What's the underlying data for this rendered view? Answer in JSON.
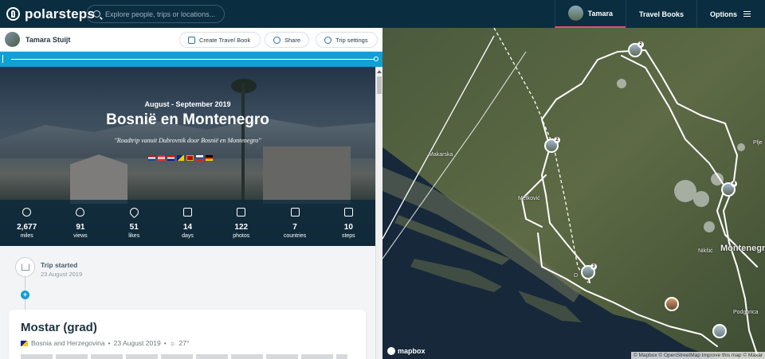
{
  "app": {
    "logo_text": "polarsteps"
  },
  "search": {
    "placeholder": "Explore people, trips or locations..."
  },
  "nav": {
    "user_name": "Tamara",
    "travel_books": "Travel Books",
    "options": "Options"
  },
  "trip_header": {
    "owner": "Tamara Stuijt",
    "create_book": "Create Travel Book",
    "share": "Share",
    "trip_settings": "Trip settings"
  },
  "hero": {
    "dates": "August - September 2019",
    "title": "Bosnië en Montenegro",
    "quote": "\"Roadtrip vanuit Dubrovnik door Bosnië en Montenegro\"",
    "flags": [
      "netherlands",
      "austria",
      "croatia",
      "bosnia",
      "montenegro",
      "slovenia",
      "germany"
    ]
  },
  "stats": [
    {
      "icon": "compass-icon",
      "value": "2,677",
      "label": "miles"
    },
    {
      "icon": "eye-icon",
      "value": "91",
      "label": "views"
    },
    {
      "icon": "heart-icon",
      "value": "51",
      "label": "likes"
    },
    {
      "icon": "calendar-icon",
      "value": "14",
      "label": "days"
    },
    {
      "icon": "camera-icon",
      "value": "122",
      "label": "photos"
    },
    {
      "icon": "passport-icon",
      "value": "7",
      "label": "countries"
    },
    {
      "icon": "footprint-icon",
      "value": "10",
      "label": "steps"
    }
  ],
  "timeline": {
    "started_title": "Trip started",
    "started_date": "23 August 2019",
    "step": {
      "title": "Mostar (grad)",
      "country": "Bosnia and Herzegovina",
      "date": "23 August 2019",
      "temp": "27°"
    }
  },
  "map": {
    "labels": {
      "makarska": "Makarska",
      "metkovic": "Metković",
      "montenegro": "Montenegro",
      "nikšić": "Nikšić",
      "pljevlja": "Plje",
      "podgorica": "Podgorica",
      "dubrovnik": "D"
    },
    "pins": [
      {
        "badge": "2"
      },
      {
        "badge": "2"
      },
      {
        "badge": "4"
      },
      {
        "badge": "3"
      }
    ],
    "brand": "mapbox",
    "attribution": "© Mapbox © OpenStreetMap  Improve this map © Maxar"
  },
  "colors": {
    "topbar": "#0a2d40",
    "progress": "#139ed6",
    "accent_underline": "#e2506b"
  }
}
